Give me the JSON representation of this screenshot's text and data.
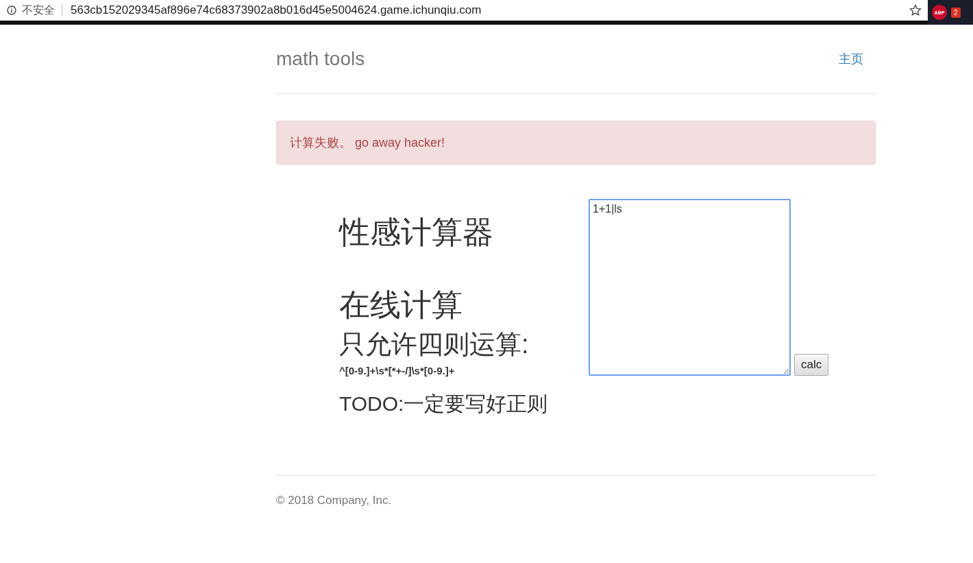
{
  "browser": {
    "security": "不安全",
    "url": "563cb152029345af896e74c68373902a8b016d45e5004624.game.ichunqiu.com",
    "extension_label": "ABP",
    "badge": "2"
  },
  "header": {
    "brand": "math tools",
    "nav": [
      {
        "label": "主页"
      }
    ]
  },
  "alert": {
    "message": "计算失败。 go away hacker!"
  },
  "calculator": {
    "title": "性感计算器",
    "subtitle": "在线计算",
    "rule_heading": "只允许四则运算:",
    "regex": "^[0-9.]+\\s*[*+-/]\\s*[0-9.]+",
    "todo": "TODO:一定要写好正则",
    "input": {
      "value": "1+1|ls",
      "focused": true
    },
    "button": "calc"
  },
  "footer": {
    "copyright": "© 2018 Company, Inc."
  }
}
